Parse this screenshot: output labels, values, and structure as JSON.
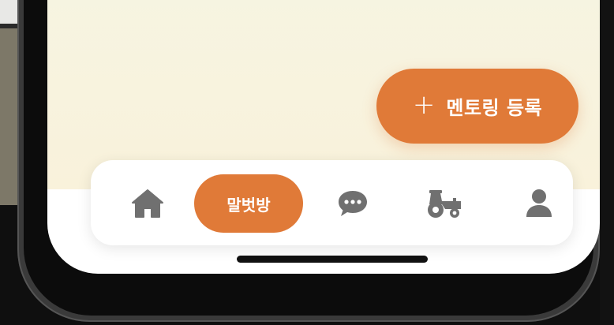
{
  "fab": {
    "plus": "+",
    "label": "멘토링 등록"
  },
  "tabbar": {
    "items": [
      {
        "id": "home",
        "icon": "home-icon"
      },
      {
        "id": "chatroom",
        "label": "말벗방",
        "active": true
      },
      {
        "id": "messages",
        "icon": "chat-bubble-icon"
      },
      {
        "id": "farm",
        "icon": "tractor-icon"
      },
      {
        "id": "profile",
        "icon": "user-icon"
      }
    ]
  },
  "colors": {
    "accent": "#e07a38",
    "icon_gray": "#707070",
    "content_bg": "#f8f3de"
  }
}
